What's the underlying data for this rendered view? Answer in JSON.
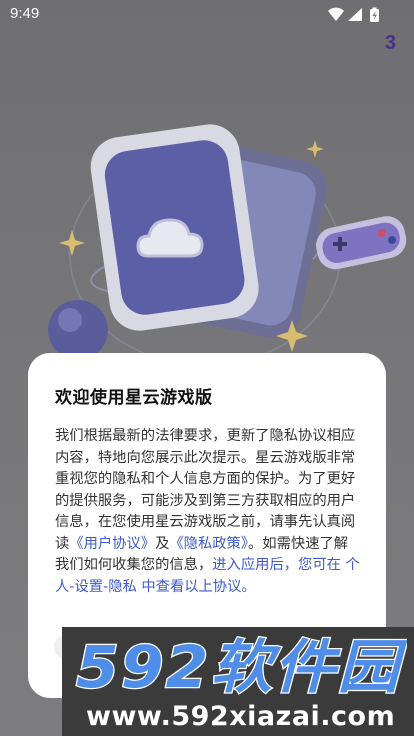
{
  "status_bar": {
    "time": "9:49",
    "icons": [
      "wifi-icon",
      "signal-icon",
      "battery-icon"
    ]
  },
  "splash": {
    "countdown": "3"
  },
  "dialog": {
    "title": "欢迎使用星云游戏版",
    "body_1": "我们根据最新的法律要求，更新了隐私协议相应内容，特地向您展示此次提示。星云游戏版非常重视您的隐私和个人信息方面的保护。为了更好的提供服务，可能涉及到第三方获取相应的用户信息，在您使用星云游戏版之前，请事先认真阅读",
    "user_agreement_link": "《用户协议》",
    "and": "及",
    "privacy_policy_link": "《隐私政策》",
    "body_2": "。如需快速了解我们如何收集您的信息，",
    "settings_hint_link": "进入应用后，您可在 个人-设置-隐私 中查看以上协议。"
  },
  "watermark": {
    "brand": "592软件园",
    "url": "www.592xiazai.com"
  },
  "colors": {
    "link": "#3d5bc9",
    "countdown": "#4a2d8a",
    "overlay": "#767679",
    "watermark_blue": "#3f7fe0"
  }
}
